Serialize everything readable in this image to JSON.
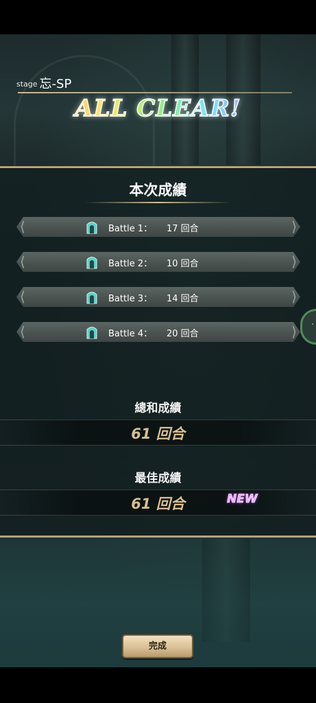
{
  "stage": {
    "prefix": "stage",
    "name": "忘-SP"
  },
  "banner": "ALL CLEAR!",
  "current_results": {
    "title": "本次成績",
    "battles": [
      {
        "label": "Battle 1：",
        "turns": "17 回合"
      },
      {
        "label": "Battle 2：",
        "turns": "10 回合"
      },
      {
        "label": "Battle 3：",
        "turns": "14 回合"
      },
      {
        "label": "Battle 4：",
        "turns": "20 回合"
      }
    ]
  },
  "total": {
    "title": "總和成績",
    "value": "61 回合"
  },
  "best": {
    "title": "最佳成績",
    "value": "61 回合",
    "badge": "NEW"
  },
  "side_tab": {
    "label": "··"
  },
  "done_button": "完成",
  "colors": {
    "gold_border": "#b7a27c",
    "score_text": "#d7bf8f",
    "new_badge": "#f0a6ff",
    "side_tab_ring": "#4f8c59"
  }
}
